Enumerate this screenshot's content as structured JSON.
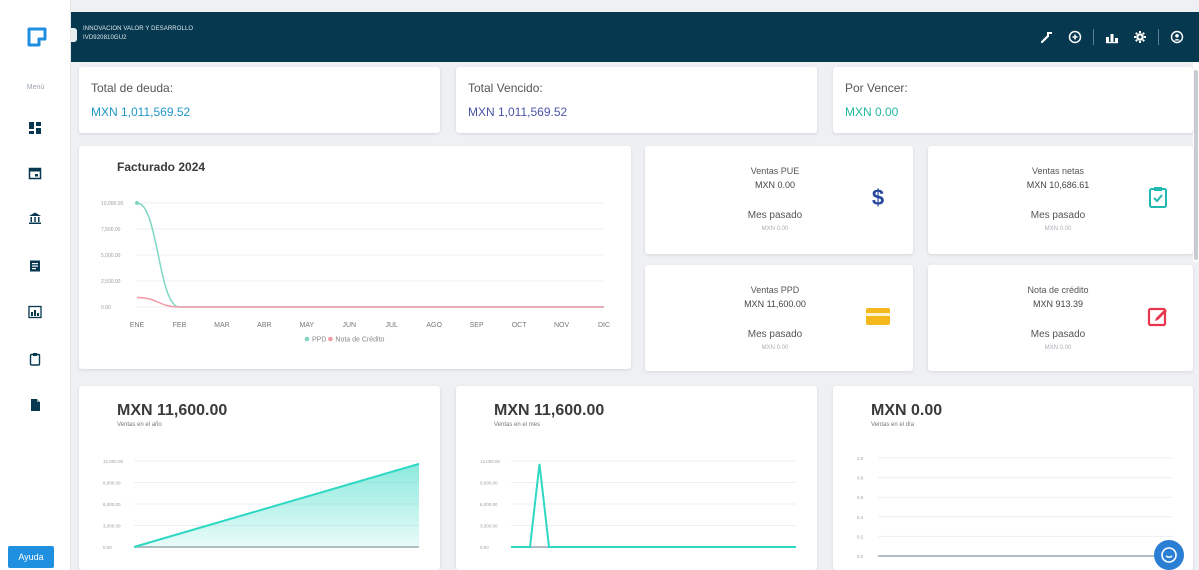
{
  "sidebar": {
    "menu_label": "Menú",
    "items": [
      "dashboard-icon",
      "calendar-icon",
      "bank-icon",
      "invoice-icon",
      "report-icon",
      "clipboard-icon",
      "document-icon"
    ],
    "help_label": "Ayuda"
  },
  "header": {
    "company_name": "INNOVACION VALOR Y DESARROLLO",
    "rfc": "IVD920810GU2",
    "icons": [
      "tools-icon",
      "add-circle-icon",
      "chart-icon",
      "gear-icon",
      "user-circle-icon"
    ]
  },
  "summary": {
    "total_deuda": {
      "label": "Total de deuda:",
      "value": "MXN 1,011,569.52",
      "color": "#2196c9"
    },
    "total_vencido": {
      "label": "Total Vencido:",
      "value": "MXN 1,011,569.52",
      "color": "#4a55a8"
    },
    "por_vencer": {
      "label": "Por Vencer:",
      "value": "MXN 0.00",
      "color": "#22b8a0"
    }
  },
  "stats": {
    "ventas_pue": {
      "title": "Ventas PUE",
      "value": "MXN 0.00",
      "prev_label": "Mes pasado",
      "prev_value": "MXN 0.00",
      "icon": "dollar-icon",
      "color": "#27489a"
    },
    "ventas_netas": {
      "title": "Ventas netas",
      "value": "MXN 10,686.61",
      "prev_label": "Mes pasado",
      "prev_value": "MXN 0.00",
      "icon": "clipboard-check-icon",
      "color": "#20b8b0"
    },
    "ventas_ppd": {
      "title": "Ventas PPD",
      "value": "MXN 11,600.00",
      "prev_label": "Mes pasado",
      "prev_value": "MXN 0.00",
      "icon": "credit-card-icon",
      "color": "#f5b91e"
    },
    "nota_credito": {
      "title": "Nota de crédito",
      "value": "MXN 913.39",
      "prev_label": "Mes pasado",
      "prev_value": "MXN 0.00",
      "icon": "edit-icon",
      "color": "#e8364f"
    }
  },
  "chart_data": [
    {
      "type": "line",
      "title": "Facturado 2024",
      "categories": [
        "ENE",
        "FEB",
        "MAR",
        "ABR",
        "MAY",
        "JUN",
        "JUL",
        "AGO",
        "SEP",
        "OCT",
        "NOV",
        "DIC"
      ],
      "yticks": [
        "0.00",
        "2,500.00",
        "5,000.00",
        "7,500.00",
        "10,000.00"
      ],
      "ylim": [
        0,
        10000
      ],
      "grid": true,
      "legend": "bottom",
      "series": [
        {
          "name": "PPD",
          "color": "#7fd6c2",
          "values": [
            10000,
            0,
            0,
            0,
            0,
            0,
            0,
            0,
            0,
            0,
            0,
            0
          ]
        },
        {
          "name": "Nota de Crédito",
          "color": "#f19aa5",
          "values": [
            913.39,
            0,
            0,
            0,
            0,
            0,
            0,
            0,
            0,
            0,
            0,
            0
          ]
        }
      ]
    },
    {
      "type": "area",
      "title": "MXN 11,600.00",
      "subtitle": "Ventas en el año",
      "yticks": [
        "0.00",
        "3,000.00",
        "6,000.00",
        "9,000.00",
        "12,000.00"
      ],
      "ylim": [
        0,
        12000
      ],
      "values": [
        0,
        11600
      ],
      "color": "#2ed8c3"
    },
    {
      "type": "line",
      "title": "MXN 11,600.00",
      "subtitle": "Ventas en el mes",
      "yticks": [
        "0.00",
        "3,000.00",
        "6,000.00",
        "9,000.00",
        "12,000.00"
      ],
      "ylim": [
        0,
        12000
      ],
      "values": [
        0,
        0,
        0,
        11600,
        0,
        0,
        0,
        0,
        0,
        0,
        0,
        0,
        0,
        0,
        0,
        0,
        0,
        0,
        0,
        0,
        0,
        0,
        0,
        0,
        0,
        0,
        0,
        0,
        0,
        0,
        0
      ],
      "color": "#2ed8c3"
    },
    {
      "type": "line",
      "title": "MXN 0.00",
      "subtitle": "Ventas en el día",
      "yticks": [
        "0.0",
        "0.2",
        "0.4",
        "0.6",
        "0.8",
        "1.0"
      ],
      "ylim": [
        0,
        1
      ],
      "values": [],
      "color": "#2ed8c3"
    }
  ]
}
